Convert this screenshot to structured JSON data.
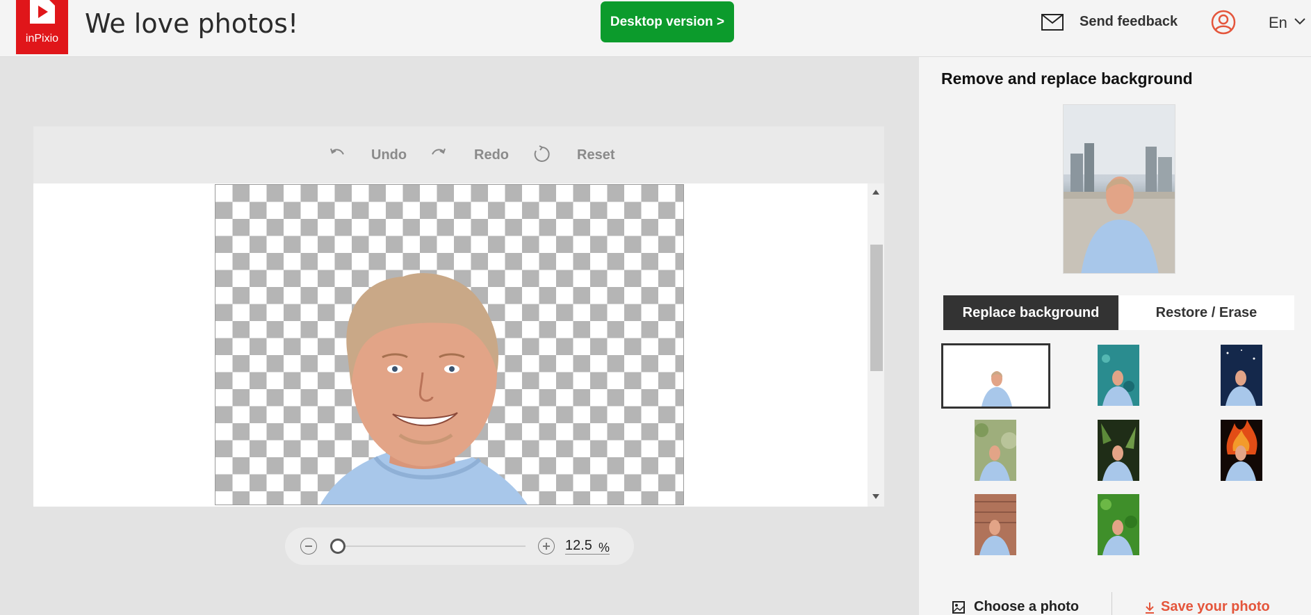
{
  "header": {
    "logo_text": "inPixio",
    "title": "We love photos!",
    "desktop_button": "Desktop version >",
    "feedback": "Send feedback",
    "language": "En",
    "brand_red": "#e0161a",
    "desktop_green": "#0c9b2c"
  },
  "toolbar": {
    "undo": "Undo",
    "redo": "Redo",
    "reset": "Reset"
  },
  "zoom": {
    "value": "12.5",
    "unit": "%"
  },
  "panel": {
    "title": "Remove and replace background",
    "tabs": [
      {
        "label": "Replace background",
        "active": true
      },
      {
        "label": "Restore / Erase",
        "active": false
      }
    ],
    "backgrounds": [
      "white",
      "teal-water",
      "starry-blue",
      "tree-leaves",
      "dark-leaves",
      "fire",
      "brick-wall",
      "green-grass"
    ],
    "choose_photo": "Choose a photo",
    "save_photo": "Save your photo",
    "save_color": "#e4553b"
  }
}
